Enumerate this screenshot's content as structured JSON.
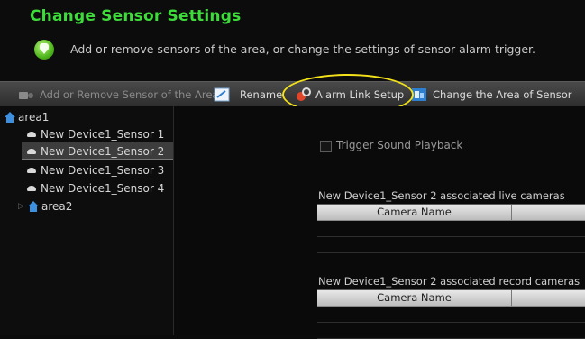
{
  "header": {
    "title": "Change Sensor Settings",
    "description": "Add or remove sensors of the area, or change the settings of sensor alarm trigger."
  },
  "toolbar": {
    "add_remove": "Add or Remove Sensor of the Area",
    "rename": "Rename",
    "alarm_link": "Alarm Link Setup",
    "change_area": "Change the Area of Sensor"
  },
  "tree": {
    "area1": "area1",
    "sensors": [
      "New Device1_Sensor 1",
      "New Device1_Sensor 2",
      "New Device1_Sensor 3",
      "New Device1_Sensor 4"
    ],
    "selected_index": 1,
    "area2": "area2"
  },
  "main": {
    "trigger_sound": "Trigger Sound Playback",
    "trigger_sound_checked": false,
    "live_label": "New Device1_Sensor 2 associated live cameras",
    "record_label": "New Device1_Sensor 2 associated record cameras",
    "camera_col": "Camera Name"
  },
  "colors": {
    "title": "#3ddc3a",
    "highlight": "#f3e11a",
    "accent_blue": "#2f7fd0"
  }
}
